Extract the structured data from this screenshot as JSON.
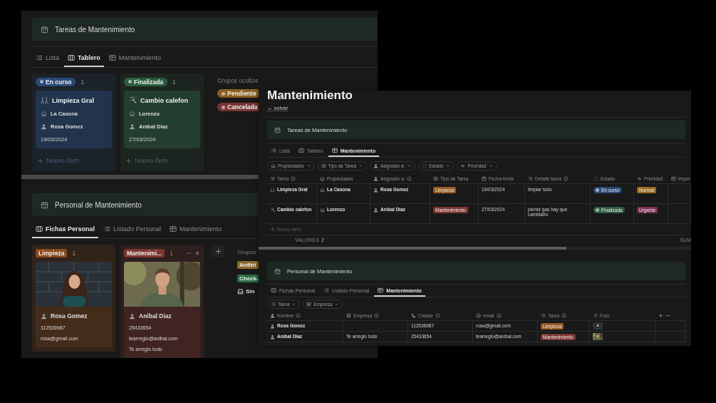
{
  "left_window": {
    "tasks": {
      "title": "Tareas de Mantenimiento",
      "tabs": [
        {
          "label": "Lista",
          "kind": "list",
          "selected": false
        },
        {
          "label": "Tablero",
          "kind": "board",
          "selected": true
        },
        {
          "label": "Mantenimiento",
          "kind": "table",
          "selected": false
        }
      ],
      "columns": [
        {
          "label": "En curso",
          "count": "1",
          "color": "#2a4a78",
          "cards": [
            {
              "title": "Limpieza Gral",
              "property": "La Casona",
              "assignee": "Rosa Gomez",
              "date": "19/03/2024"
            }
          ],
          "add_label": "Nuevo ítem"
        },
        {
          "label": "Finalizada",
          "count": "1",
          "color": "#2b5c3f",
          "cards": [
            {
              "title": "Cambio calefon",
              "property": "Lorenzo",
              "assignee": "Anibal Diaz",
              "date": "27/03/2024"
            }
          ],
          "add_label": "Nuevo ítem"
        }
      ],
      "hidden_groups": {
        "title": "Grupos ocultos",
        "groups": [
          {
            "label": "Pendiente",
            "kind": "status",
            "color": "#8a6020"
          },
          {
            "label": "Cancelada",
            "kind": "status",
            "color": "#7a3533"
          }
        ]
      }
    },
    "staff": {
      "title": "Personal de Mantenimiento",
      "tabs": [
        {
          "label": "Fichas Personal",
          "kind": "board",
          "selected": true
        },
        {
          "label": "Listado Personal",
          "kind": "list",
          "selected": false
        },
        {
          "label": "Mantenimiento",
          "kind": "table",
          "selected": false
        }
      ],
      "columns": [
        {
          "label": "Limpieza",
          "count": "1",
          "color": "#8a4a1c",
          "hovered": false,
          "cards": [
            {
              "photo": {
                "kind": "picture"
              },
              "name": "Rosa Gomez",
              "phone": "112536987",
              "email": "rosa@gmail.com"
            }
          ]
        },
        {
          "label": "Mantenimi...",
          "count": "1",
          "color": "#7c3531",
          "hovered": true,
          "cards": [
            {
              "photo": {
                "kind": "picture"
              },
              "name": "Anibal Diaz",
              "phone": "25433654",
              "email": "tearreglo@anibal.com",
              "company": "Te arreglo todo"
            }
          ]
        }
      ],
      "hidden_groups": {
        "title": "Grupos",
        "groups": [
          {
            "label": "Anfitri",
            "kind": "tag",
            "color": "#8a6a2a"
          },
          {
            "label": "Check-",
            "kind": "tag",
            "color": "#2d6b45"
          },
          {
            "label": "Sin",
            "kind": "none"
          }
        ]
      }
    }
  },
  "right_window": {
    "title": "Mantenimiento",
    "back_link": "← volver",
    "tasks": {
      "title": "Tareas de Mantenimiento",
      "tabs": [
        {
          "label": "Lista",
          "kind": "list",
          "selected": false
        },
        {
          "label": "Tablero",
          "kind": "board",
          "selected": false
        },
        {
          "label": "Mantenimiento",
          "kind": "table",
          "selected": true
        }
      ],
      "filters": [
        "Propiedades",
        "Tipo de Tarea",
        "Asignado a:",
        "Estado",
        "Prioridad"
      ],
      "columns": [
        {
          "label": "Tarea",
          "info": true
        },
        {
          "label": "Propiedades",
          "info": false
        },
        {
          "label": "Asignado a:",
          "info": true
        },
        {
          "label": "Tipo de Tarea",
          "info": false
        },
        {
          "label": "Fecha límite",
          "info": false
        },
        {
          "label": "Detalle tarea",
          "info": true
        },
        {
          "label": "Estado",
          "info": false
        },
        {
          "label": "Prioridad",
          "info": false
        },
        {
          "label": "Impor",
          "info": false
        }
      ],
      "rows": [
        {
          "cells": [
            {
              "kind": "title",
              "text": "Limpieza Gral"
            },
            {
              "kind": "relation",
              "text": "La Casona"
            },
            {
              "kind": "person",
              "text": "Rosa Gomez"
            },
            {
              "kind": "select",
              "text": "Limpieza",
              "color": "#9b5a22"
            },
            {
              "kind": "text",
              "text": "19/03/2024"
            },
            {
              "kind": "text",
              "text": "limpiar todo"
            },
            {
              "kind": "status",
              "text": "En curso",
              "color": "#2a4a78"
            },
            {
              "kind": "select",
              "text": "Normal",
              "color": "#9a6a1e"
            }
          ]
        },
        {
          "cells": [
            {
              "kind": "title",
              "text": "Cambio calefon"
            },
            {
              "kind": "relation",
              "text": "Lorenzo"
            },
            {
              "kind": "person",
              "text": "Anibal Diaz"
            },
            {
              "kind": "select",
              "text": "Mantenimiento",
              "color": "#7c3531"
            },
            {
              "kind": "text",
              "text": "27/03/2024"
            },
            {
              "kind": "text",
              "text": "pierde gas hay que cambiarlo"
            },
            {
              "kind": "status",
              "text": "Finalizada",
              "color": "#2b5c3f"
            },
            {
              "kind": "select",
              "text": "Urgente",
              "color": "#7a2e54"
            }
          ]
        }
      ],
      "add_label": "Nuevo ítem",
      "calc_label": "VALORES",
      "calc_value": "2",
      "sum_label": "SUM"
    },
    "staff": {
      "title": "Personal de Mantenimiento",
      "tabs": [
        {
          "label": "Fichas Personal",
          "kind": "board",
          "selected": false
        },
        {
          "label": "Listado Personal",
          "kind": "list",
          "selected": false
        },
        {
          "label": "Mantenimiento",
          "kind": "table",
          "selected": true
        }
      ],
      "filters": [
        "Tarea",
        "Empresa"
      ],
      "columns": [
        {
          "label": "Nombre",
          "info": true
        },
        {
          "label": "Empresa",
          "info": true
        },
        {
          "label": "Celular",
          "info": true
        },
        {
          "label": "email",
          "info": true
        },
        {
          "label": "Tarea",
          "info": true
        },
        {
          "label": "Foto",
          "info": false
        }
      ],
      "rows": [
        {
          "cells": [
            {
              "kind": "title",
              "text": "Rosa Gomez"
            },
            {
              "kind": "empty"
            },
            {
              "kind": "text",
              "text": "112536987"
            },
            {
              "kind": "text",
              "text": "rosa@gmail.com"
            },
            {
              "kind": "select",
              "text": "Limpieza",
              "color": "#9b5a22"
            },
            {
              "kind": "picture"
            }
          ]
        },
        {
          "cells": [
            {
              "kind": "title",
              "text": "Anibal Diaz"
            },
            {
              "kind": "text",
              "text": "Te arreglo todo"
            },
            {
              "kind": "text",
              "text": "25433654"
            },
            {
              "kind": "text",
              "text": "tearreglo@anibal.com"
            },
            {
              "kind": "select",
              "text": "Mantenimiento",
              "color": "#7c3531"
            },
            {
              "kind": "picture"
            }
          ]
        }
      ]
    }
  }
}
